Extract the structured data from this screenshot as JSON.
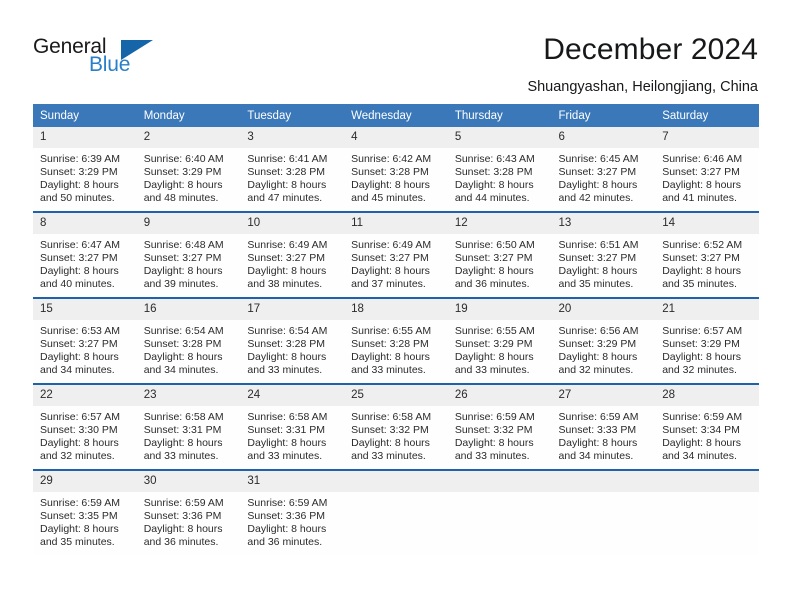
{
  "brand": {
    "name_part1": "General",
    "name_part2": "Blue",
    "logo_icon": "triangle-icon",
    "accent_color": "#2a7fc9",
    "triangle_color": "#1565a8"
  },
  "header": {
    "title": "December 2024",
    "subtitle": "Shuangyashan, Heilongjiang, China"
  },
  "colors": {
    "header_blue": "#3a78b9",
    "separator_blue": "#1f62aa",
    "daynum_band": "#efefef",
    "text": "#2b2b2b"
  },
  "calendar": {
    "weekday_headers": [
      "Sunday",
      "Monday",
      "Tuesday",
      "Wednesday",
      "Thursday",
      "Friday",
      "Saturday"
    ],
    "weeks": [
      [
        {
          "day": "1",
          "sunrise": "Sunrise: 6:39 AM",
          "sunset": "Sunset: 3:29 PM",
          "daylight_line1": "Daylight: 8 hours",
          "daylight_line2": "and 50 minutes."
        },
        {
          "day": "2",
          "sunrise": "Sunrise: 6:40 AM",
          "sunset": "Sunset: 3:29 PM",
          "daylight_line1": "Daylight: 8 hours",
          "daylight_line2": "and 48 minutes."
        },
        {
          "day": "3",
          "sunrise": "Sunrise: 6:41 AM",
          "sunset": "Sunset: 3:28 PM",
          "daylight_line1": "Daylight: 8 hours",
          "daylight_line2": "and 47 minutes."
        },
        {
          "day": "4",
          "sunrise": "Sunrise: 6:42 AM",
          "sunset": "Sunset: 3:28 PM",
          "daylight_line1": "Daylight: 8 hours",
          "daylight_line2": "and 45 minutes."
        },
        {
          "day": "5",
          "sunrise": "Sunrise: 6:43 AM",
          "sunset": "Sunset: 3:28 PM",
          "daylight_line1": "Daylight: 8 hours",
          "daylight_line2": "and 44 minutes."
        },
        {
          "day": "6",
          "sunrise": "Sunrise: 6:45 AM",
          "sunset": "Sunset: 3:27 PM",
          "daylight_line1": "Daylight: 8 hours",
          "daylight_line2": "and 42 minutes."
        },
        {
          "day": "7",
          "sunrise": "Sunrise: 6:46 AM",
          "sunset": "Sunset: 3:27 PM",
          "daylight_line1": "Daylight: 8 hours",
          "daylight_line2": "and 41 minutes."
        }
      ],
      [
        {
          "day": "8",
          "sunrise": "Sunrise: 6:47 AM",
          "sunset": "Sunset: 3:27 PM",
          "daylight_line1": "Daylight: 8 hours",
          "daylight_line2": "and 40 minutes."
        },
        {
          "day": "9",
          "sunrise": "Sunrise: 6:48 AM",
          "sunset": "Sunset: 3:27 PM",
          "daylight_line1": "Daylight: 8 hours",
          "daylight_line2": "and 39 minutes."
        },
        {
          "day": "10",
          "sunrise": "Sunrise: 6:49 AM",
          "sunset": "Sunset: 3:27 PM",
          "daylight_line1": "Daylight: 8 hours",
          "daylight_line2": "and 38 minutes."
        },
        {
          "day": "11",
          "sunrise": "Sunrise: 6:49 AM",
          "sunset": "Sunset: 3:27 PM",
          "daylight_line1": "Daylight: 8 hours",
          "daylight_line2": "and 37 minutes."
        },
        {
          "day": "12",
          "sunrise": "Sunrise: 6:50 AM",
          "sunset": "Sunset: 3:27 PM",
          "daylight_line1": "Daylight: 8 hours",
          "daylight_line2": "and 36 minutes."
        },
        {
          "day": "13",
          "sunrise": "Sunrise: 6:51 AM",
          "sunset": "Sunset: 3:27 PM",
          "daylight_line1": "Daylight: 8 hours",
          "daylight_line2": "and 35 minutes."
        },
        {
          "day": "14",
          "sunrise": "Sunrise: 6:52 AM",
          "sunset": "Sunset: 3:27 PM",
          "daylight_line1": "Daylight: 8 hours",
          "daylight_line2": "and 35 minutes."
        }
      ],
      [
        {
          "day": "15",
          "sunrise": "Sunrise: 6:53 AM",
          "sunset": "Sunset: 3:27 PM",
          "daylight_line1": "Daylight: 8 hours",
          "daylight_line2": "and 34 minutes."
        },
        {
          "day": "16",
          "sunrise": "Sunrise: 6:54 AM",
          "sunset": "Sunset: 3:28 PM",
          "daylight_line1": "Daylight: 8 hours",
          "daylight_line2": "and 34 minutes."
        },
        {
          "day": "17",
          "sunrise": "Sunrise: 6:54 AM",
          "sunset": "Sunset: 3:28 PM",
          "daylight_line1": "Daylight: 8 hours",
          "daylight_line2": "and 33 minutes."
        },
        {
          "day": "18",
          "sunrise": "Sunrise: 6:55 AM",
          "sunset": "Sunset: 3:28 PM",
          "daylight_line1": "Daylight: 8 hours",
          "daylight_line2": "and 33 minutes."
        },
        {
          "day": "19",
          "sunrise": "Sunrise: 6:55 AM",
          "sunset": "Sunset: 3:29 PM",
          "daylight_line1": "Daylight: 8 hours",
          "daylight_line2": "and 33 minutes."
        },
        {
          "day": "20",
          "sunrise": "Sunrise: 6:56 AM",
          "sunset": "Sunset: 3:29 PM",
          "daylight_line1": "Daylight: 8 hours",
          "daylight_line2": "and 32 minutes."
        },
        {
          "day": "21",
          "sunrise": "Sunrise: 6:57 AM",
          "sunset": "Sunset: 3:29 PM",
          "daylight_line1": "Daylight: 8 hours",
          "daylight_line2": "and 32 minutes."
        }
      ],
      [
        {
          "day": "22",
          "sunrise": "Sunrise: 6:57 AM",
          "sunset": "Sunset: 3:30 PM",
          "daylight_line1": "Daylight: 8 hours",
          "daylight_line2": "and 32 minutes."
        },
        {
          "day": "23",
          "sunrise": "Sunrise: 6:58 AM",
          "sunset": "Sunset: 3:31 PM",
          "daylight_line1": "Daylight: 8 hours",
          "daylight_line2": "and 33 minutes."
        },
        {
          "day": "24",
          "sunrise": "Sunrise: 6:58 AM",
          "sunset": "Sunset: 3:31 PM",
          "daylight_line1": "Daylight: 8 hours",
          "daylight_line2": "and 33 minutes."
        },
        {
          "day": "25",
          "sunrise": "Sunrise: 6:58 AM",
          "sunset": "Sunset: 3:32 PM",
          "daylight_line1": "Daylight: 8 hours",
          "daylight_line2": "and 33 minutes."
        },
        {
          "day": "26",
          "sunrise": "Sunrise: 6:59 AM",
          "sunset": "Sunset: 3:32 PM",
          "daylight_line1": "Daylight: 8 hours",
          "daylight_line2": "and 33 minutes."
        },
        {
          "day": "27",
          "sunrise": "Sunrise: 6:59 AM",
          "sunset": "Sunset: 3:33 PM",
          "daylight_line1": "Daylight: 8 hours",
          "daylight_line2": "and 34 minutes."
        },
        {
          "day": "28",
          "sunrise": "Sunrise: 6:59 AM",
          "sunset": "Sunset: 3:34 PM",
          "daylight_line1": "Daylight: 8 hours",
          "daylight_line2": "and 34 minutes."
        }
      ],
      [
        {
          "day": "29",
          "sunrise": "Sunrise: 6:59 AM",
          "sunset": "Sunset: 3:35 PM",
          "daylight_line1": "Daylight: 8 hours",
          "daylight_line2": "and 35 minutes."
        },
        {
          "day": "30",
          "sunrise": "Sunrise: 6:59 AM",
          "sunset": "Sunset: 3:36 PM",
          "daylight_line1": "Daylight: 8 hours",
          "daylight_line2": "and 36 minutes."
        },
        {
          "day": "31",
          "sunrise": "Sunrise: 6:59 AM",
          "sunset": "Sunset: 3:36 PM",
          "daylight_line1": "Daylight: 8 hours",
          "daylight_line2": "and 36 minutes."
        },
        {
          "day": "",
          "sunrise": "",
          "sunset": "",
          "daylight_line1": "",
          "daylight_line2": ""
        },
        {
          "day": "",
          "sunrise": "",
          "sunset": "",
          "daylight_line1": "",
          "daylight_line2": ""
        },
        {
          "day": "",
          "sunrise": "",
          "sunset": "",
          "daylight_line1": "",
          "daylight_line2": ""
        },
        {
          "day": "",
          "sunrise": "",
          "sunset": "",
          "daylight_line1": "",
          "daylight_line2": ""
        }
      ]
    ]
  }
}
